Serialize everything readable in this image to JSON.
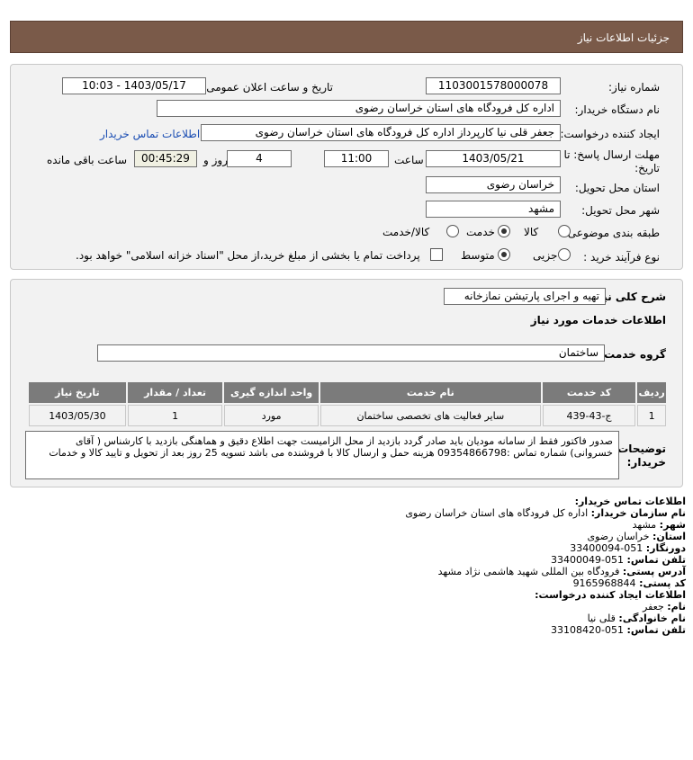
{
  "header": {
    "title": "جزئیات اطلاعات نیاز"
  },
  "form": {
    "need_number_label": "شماره نیاز:",
    "need_number": "1103001578000078",
    "announce_label": "تاریخ و ساعت اعلان عمومی:",
    "announce_value": "1403/05/17 - 10:03",
    "buyer_org_label": "نام دستگاه خریدار:",
    "buyer_org": "اداره کل فرودگاه های استان خراسان رضوی",
    "creator_label": "ایجاد کننده درخواست:",
    "creator": "جعفر قلی نیا کارپرداز اداره کل فرودگاه های استان خراسان رضوی",
    "buyer_contact_link": "اطلاعات تماس خریدار",
    "deadline_label_1": "مهلت ارسال پاسخ: تا",
    "deadline_label_2": "تاریخ:",
    "deadline_date": "1403/05/21",
    "time_label": "ساعت",
    "deadline_time": "11:00",
    "days_value": "4",
    "days_label": "روز و",
    "remaining_time": "00:45:29",
    "remaining_label": "ساعت باقی مانده",
    "province_label": "استان محل تحویل:",
    "province": "خراسان رضوی",
    "city_label": "شهر محل تحویل:",
    "city": "مشهد",
    "category_label": "طبقه بندی موضوعی:",
    "category_options": [
      "کالا",
      "خدمت",
      "کالا/خدمت"
    ],
    "category_selected": "خدمت",
    "process_label": "نوع فرآیند خرید :",
    "process_options": [
      "جزیی",
      "متوسط"
    ],
    "process_selected": "متوسط",
    "payment_note": "پرداخت تمام یا بخشی از مبلغ خرید،از محل \"اسناد خزانه اسلامی\" خواهد بود."
  },
  "details": {
    "summary_label": "شرح کلی نیاز:",
    "summary": "تهیه و اجرای پارتیشن نمازخانه",
    "services_heading": "اطلاعات خدمات مورد نیاز",
    "service_group_label": "گروه خدمت:",
    "service_group": "ساختمان",
    "table": {
      "headers": [
        "ردیف",
        "کد خدمت",
        "نام خدمت",
        "واحد اندازه گیری",
        "تعداد / مقدار",
        "تاریخ نیاز"
      ],
      "rows": [
        [
          "1",
          "ج-43-439",
          "سایر فعالیت های تخصصی ساختمان",
          "مورد",
          "1",
          "1403/05/30"
        ]
      ]
    },
    "buyer_notes_label_1": "توضیحات",
    "buyer_notes_label_2": "خریدار:",
    "buyer_notes": "صدور فاکتور فقط از سامانه مودیان باید صادر گردد بازدید از محل الزامیست جهت اطلاع دقیق و هماهنگی بازدید با کارشناس ( آقای خسروانی) شماره تماس :09354866798 هزینه حمل و ارسال کالا با فروشنده می باشد تسویه 25 روز بعد از تحویل و تایید کالا و خدمات"
  },
  "contact": {
    "buyer_heading": "اطلاعات تماس خریدار:",
    "org_label": "نام سازمان خریدار:",
    "org": "اداره کل فرودگاه های استان خراسان رضوی",
    "city_label": "شهر:",
    "city": "مشهد",
    "province_label": "استان:",
    "province": "خراسان رضوی",
    "fax_label": "دورنگار:",
    "fax": "051-33400094",
    "phone_label": "تلفن تماس:",
    "phone": "051-33400049",
    "address_label": "آدرس پستی:",
    "address": "فرودگاه بین المللی شهید هاشمی نژاد مشهد",
    "postal_label": "کد پستی:",
    "postal": "9165968844",
    "creator_heading": "اطلاعات ایجاد کننده درخواست:",
    "first_name_label": "نام:",
    "first_name": "جعفر",
    "last_name_label": "نام خانوادگی:",
    "last_name": "قلی نیا",
    "creator_phone_label": "تلفن تماس:",
    "creator_phone": "051-33108420"
  }
}
